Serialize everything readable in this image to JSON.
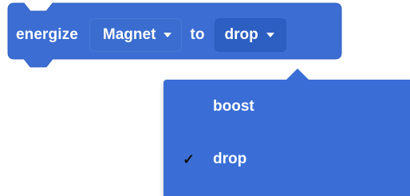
{
  "block": {
    "label": "energize",
    "connector": "to",
    "target_field": {
      "value": "Magnet"
    },
    "action_field": {
      "value": "drop"
    }
  },
  "dropdown": {
    "options": [
      {
        "label": "boost",
        "selected": false,
        "check": ""
      },
      {
        "label": "drop",
        "selected": true,
        "check": "✓"
      }
    ]
  },
  "colors": {
    "block": "#3b6dd3",
    "dropdown": "#3a6ed6",
    "field": "#2d5fc2",
    "text": "#ffffff"
  }
}
